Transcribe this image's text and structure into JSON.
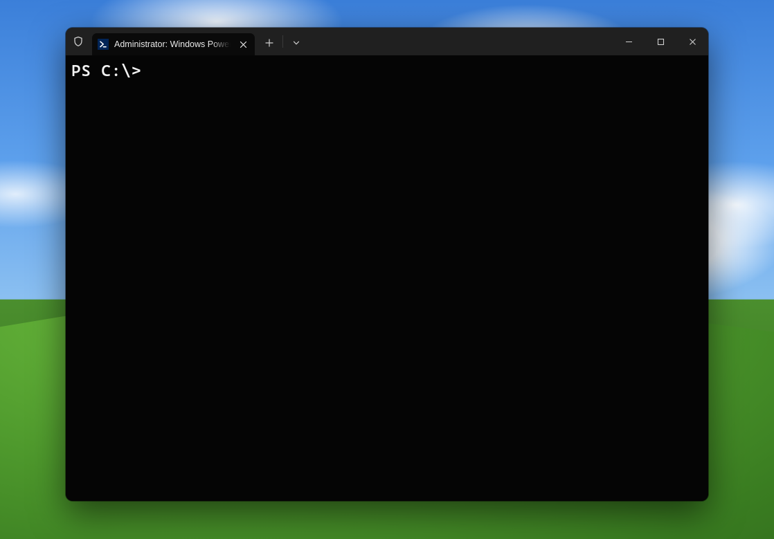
{
  "tab": {
    "title": "Administrator: Windows PowerShell"
  },
  "terminal": {
    "prompt": "PS C:\\> "
  }
}
